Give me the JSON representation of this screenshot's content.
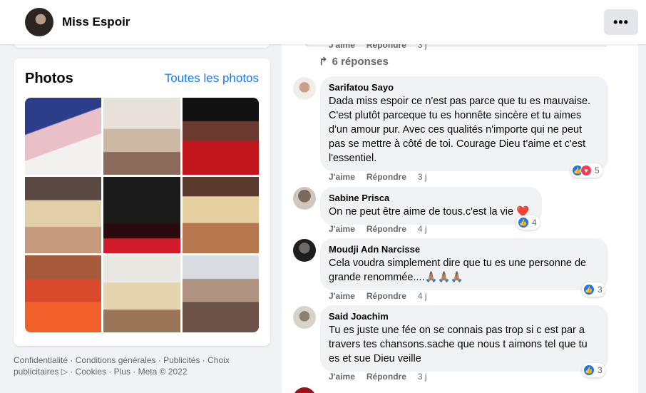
{
  "header": {
    "name": "Miss Espoir",
    "more": "•••"
  },
  "photos": {
    "title": "Photos",
    "see_all": "Toutes les photos"
  },
  "footer": {
    "line1": "Confidentialité · Conditions générales · Publicités · Choix",
    "line2": "publicitaires ▷ · Cookies · Plus · Meta © 2022"
  },
  "prev": {
    "like": "J'aime",
    "reply": "Répondre",
    "time": "3 j",
    "replies": "6 réponses"
  },
  "comments": [
    {
      "author": "Sarifatou Sayo",
      "text": "Dada miss espoir ce n'est pas parce que tu es mauvaise. C'est plutôt parceque tu es honnête sincère et tu aimes d'un amour pur. Avec ces qualités n'importe qui ne peut pas se mettre à côté de toi. Courage Dieu t'aime et c'est l'essentiel.",
      "like": "J'aime",
      "reply": "Répondre",
      "time": "3 j",
      "reactions": "5"
    },
    {
      "author": "Sabine Prisca",
      "text": "On ne peut être aime de tous.c'est la vie",
      "emoji": "❤️",
      "like": "J'aime",
      "reply": "Répondre",
      "time": "4 j",
      "reactions": "4"
    },
    {
      "author": "Moudji Adn Narcisse",
      "text": "Cela voudra simplement dire que tu es une personne de grande renommée....",
      "emoji": "🙏🏽🙏🏽🙏🏽",
      "like": "J'aime",
      "reply": "Répondre",
      "time": "4 j",
      "reactions": "3"
    },
    {
      "author": "Said Joachim",
      "text": "Tu es juste une fée on se connais pas trop si c est par a travers tes chansons.sache que nous t aimons tel que tu es et sue Dieu veille",
      "like": "J'aime",
      "reply": "Répondre",
      "time": "3 j",
      "reactions": "3"
    }
  ]
}
